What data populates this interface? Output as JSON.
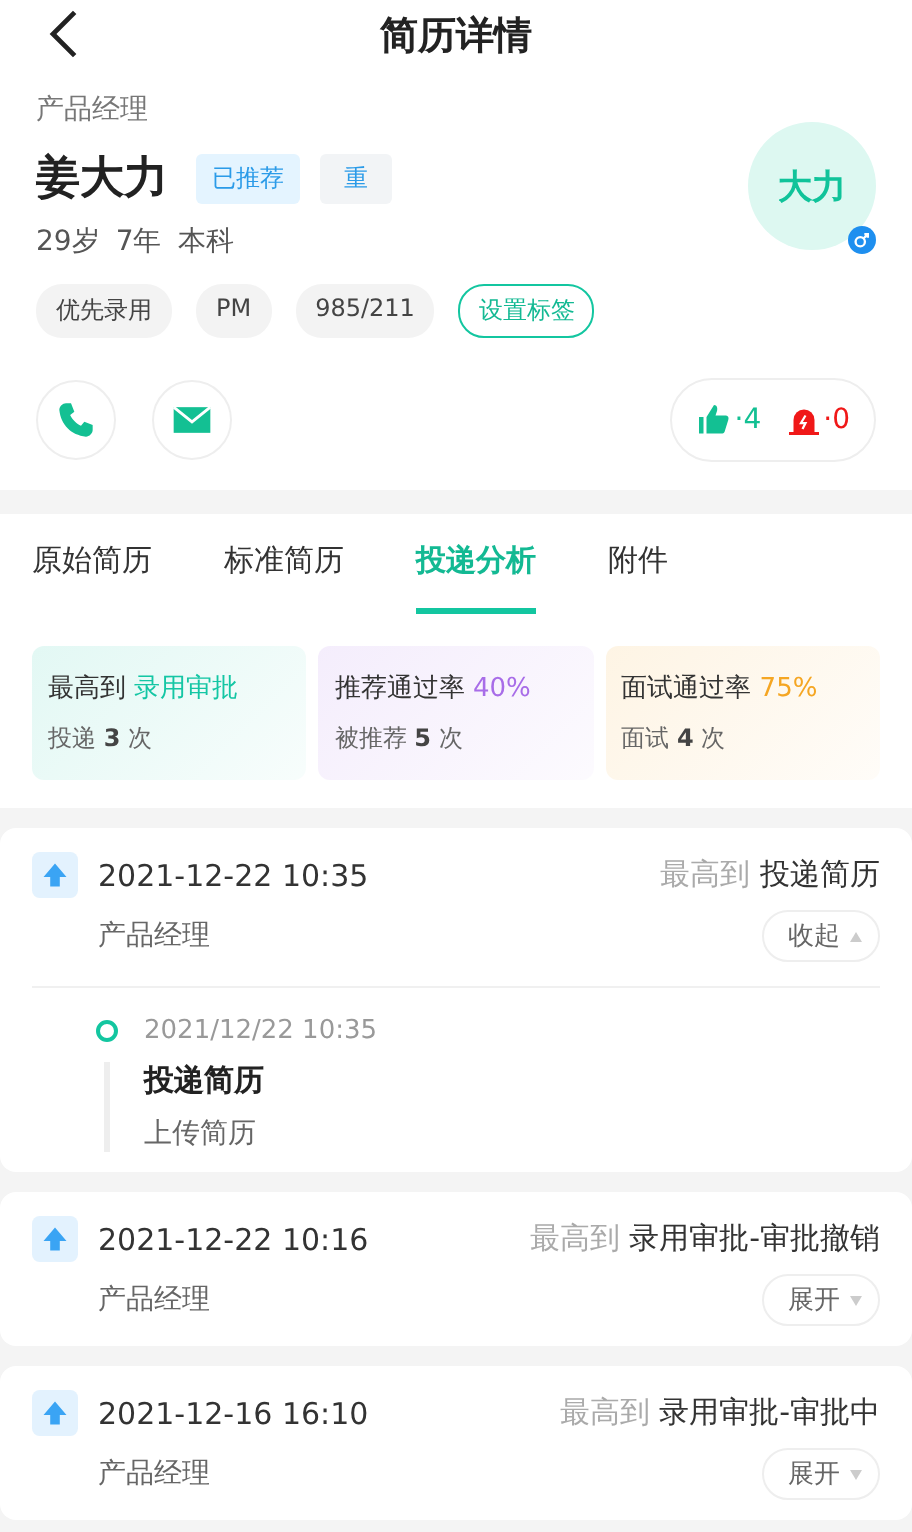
{
  "header": {
    "title": "简历详情"
  },
  "profile": {
    "position": "产品经理",
    "name": "姜大力",
    "badges": [
      {
        "label": "已推荐",
        "kind": "recommended"
      },
      {
        "label": "重",
        "kind": "repeat"
      }
    ],
    "meta": [
      "29岁",
      "7年",
      "本科"
    ],
    "tags": [
      "优先录用",
      "PM",
      "985/211"
    ],
    "tag_button": "设置标签",
    "avatar": "大力",
    "likes": "·4",
    "alerts": "·0"
  },
  "tabs": [
    {
      "label": "原始简历",
      "selected": false
    },
    {
      "label": "标准简历",
      "selected": false
    },
    {
      "label": "投递分析",
      "selected": true
    },
    {
      "label": "附件",
      "selected": false
    }
  ],
  "stats": [
    {
      "label": "最高到",
      "value": "录用审批",
      "color": "#14c6a4",
      "sub": "投递 **3** 次"
    },
    {
      "label": "推荐通过率",
      "value": "40%",
      "color": "#a86de8",
      "sub": "被推荐 **5** 次"
    },
    {
      "label": "面试通过率",
      "value": "75%",
      "color": "#f5a623",
      "sub": "面试 **4** 次"
    }
  ],
  "records": [
    {
      "time": "2021-12-22 10:35",
      "stage_label": "最高到",
      "stage": "投递简历",
      "position": "产品经理",
      "toggle": "收起",
      "expanded": true,
      "events": [
        {
          "time": "2021/12/22 10:35",
          "title": "投递简历",
          "detail": "上传简历"
        }
      ]
    },
    {
      "time": "2021-12-22 10:16",
      "stage_label": "最高到",
      "stage": "录用审批-审批撤销",
      "position": "产品经理",
      "toggle": "展开",
      "expanded": false
    },
    {
      "time": "2021-12-16 16:10",
      "stage_label": "最高到",
      "stage": "录用审批-审批中",
      "position": "产品经理",
      "toggle": "展开",
      "expanded": false
    }
  ]
}
